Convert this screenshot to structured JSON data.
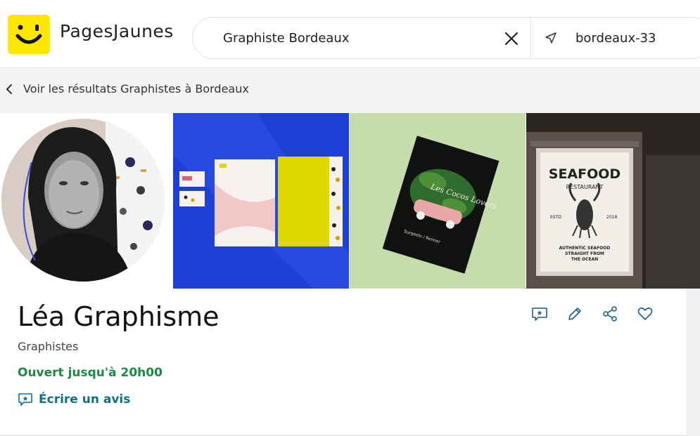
{
  "header": {
    "brand": "PagesJaunes",
    "search_value": "Graphiste Bordeaux",
    "location_value": "bordeaux-33"
  },
  "backbar": {
    "label": "Voir les résultats Graphistes à Bordeaux"
  },
  "gallery": {
    "tile3_text": [
      "Les Cocos Lovers",
      "Surgeelo / Renner"
    ],
    "tile4_text": {
      "title": "SEAFOOD",
      "subtitle": "RESTAURANT",
      "estd": "ESTD",
      "year": "2018",
      "tagline": [
        "AUTHENTIC SEAFOOD",
        "STRAIGHT FROM",
        "THE OCEAN"
      ]
    }
  },
  "business": {
    "name": "Léa Graphisme",
    "category": "Graphistes",
    "hours": "Ouvert jusqu'à 20h00",
    "review_label": "Écrire un avis"
  },
  "colors": {
    "brand_yellow": "#ffe700",
    "open_green": "#1a8a44",
    "link_teal": "#0d6f8a",
    "action_blue": "#1b5f8f"
  },
  "icons": [
    "logo-smile-icon",
    "close-icon",
    "location-arrow-icon",
    "chevron-left-icon",
    "review-icon",
    "pencil-icon",
    "share-icon",
    "heart-icon"
  ]
}
